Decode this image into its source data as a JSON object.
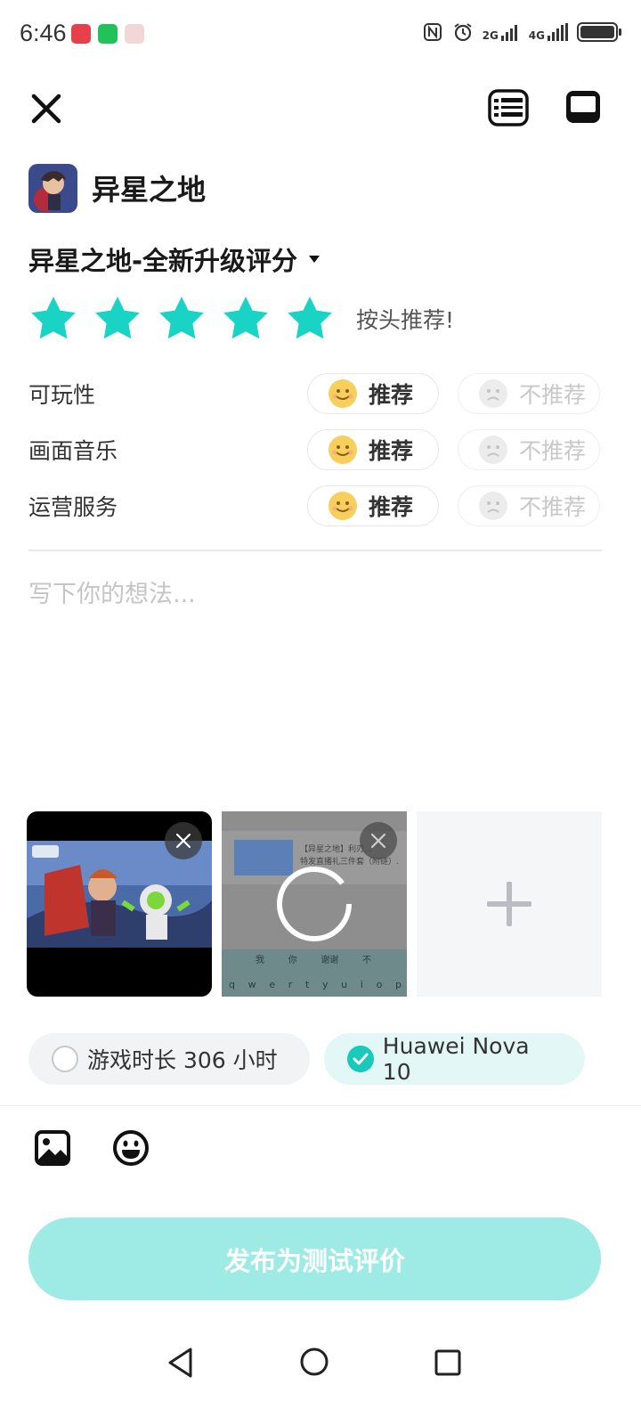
{
  "status_bar": {
    "time": "6:46",
    "net_2g": "2G",
    "net_4g": "4G"
  },
  "app": {
    "name": "异星之地"
  },
  "rating": {
    "title": "异星之地-全新升级评分",
    "stars": 5,
    "max_stars": 5,
    "hint": "按头推荐!",
    "star_color": "#19d3c5"
  },
  "criteria": [
    {
      "label": "可玩性",
      "yes": "推荐",
      "no": "不推荐",
      "selected": "yes"
    },
    {
      "label": "画面音乐",
      "yes": "推荐",
      "no": "不推荐",
      "selected": "yes"
    },
    {
      "label": "运营服务",
      "yes": "推荐",
      "no": "不推荐",
      "selected": "yes"
    }
  ],
  "review": {
    "placeholder": "写下你的想法..."
  },
  "media": {
    "thumb2_caption_line1": "【异星之地】利刃...",
    "thumb2_caption_line2": "特发直播礼三件套（附链）...",
    "thumb2_kb_row1": [
      "我",
      "你",
      "谢谢",
      "不"
    ],
    "thumb2_kb_row2": [
      "q",
      "w",
      "e",
      "r",
      "t",
      "y",
      "u",
      "i",
      "o",
      "p"
    ]
  },
  "chips": {
    "hours": "游戏时长 306 小时",
    "device": "Huawei Nova 10"
  },
  "publish": {
    "label": "发布为测试评价",
    "color": "#9eeae4"
  },
  "icons": {
    "close": "close-icon",
    "rules": "rules-icon",
    "chat": "chat-icon",
    "image": "image-icon",
    "emoji": "emoji-icon"
  }
}
